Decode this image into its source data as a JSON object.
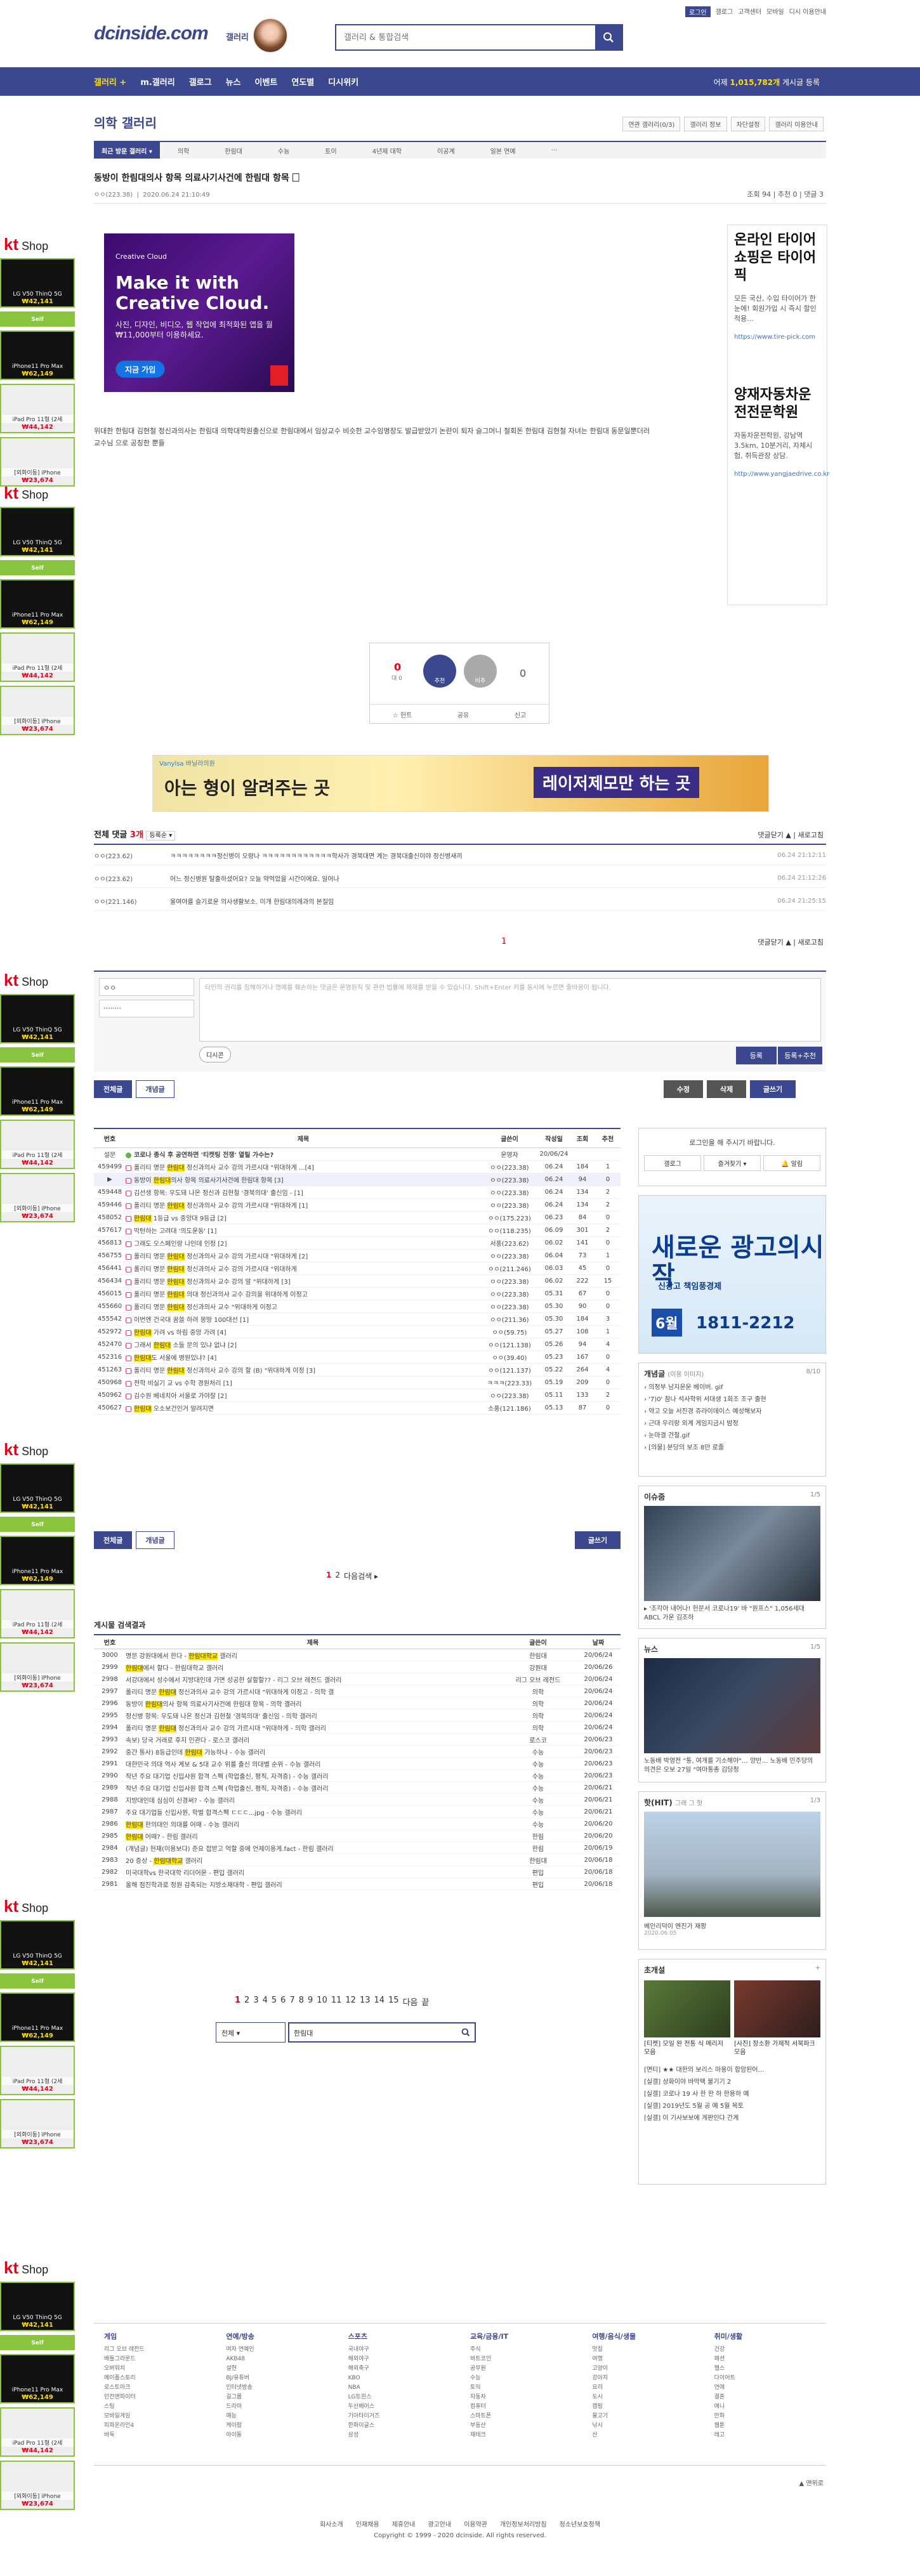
{
  "header": {
    "logo": "dcinside.com",
    "logo_sub": "갤러리",
    "search_placeholder": "갤러리 & 통합검색",
    "top_links": [
      "로그인",
      "갤로그",
      "고객센터",
      "모바일",
      "디시 이용안내"
    ],
    "nav": [
      "갤러리 +",
      "m.갤러리",
      "갤로그",
      "뉴스",
      "이벤트",
      "연도별",
      "디시위키"
    ],
    "total_label": "어제",
    "total_count": "1,015,782개",
    "total_suffix": "게시글 등록"
  },
  "gallery": {
    "title": "의학 갤러리",
    "tools": [
      "연관 갤러리(0/3)",
      "갤러리 정보",
      "차단설정",
      "갤러리 이용안내"
    ],
    "tabs": [
      "최근 방문 갤러리 ▾",
      "의학",
      "한림대",
      "수능",
      "토이",
      "4년제 대학",
      "이공계",
      "일본 연예",
      "···"
    ]
  },
  "post": {
    "title": "동방이 한림대의사 항목 의료사기사건에 한림대 항목 🗌",
    "writer": "ㅇㅇ(223.38)",
    "date": "2020.06.24 21:10:49",
    "stats": "조회 94  |  추천 0  |  댓글 3",
    "body": "위대한 한림대 김현철 정신과의사는 한림대 의학대학원출신으로 한림대에서 임상교수 비슷한 교수임명장도 발급받았기 논란이 퇴자 슬그머니 철회돈 한림대 김현철 자녀는 한림대 동문일뿐더러 교수님 으로 공칭한 뿐들"
  },
  "ads": {
    "kt_logo": "kt",
    "kt_shop": "Shop",
    "kt_items": [
      {
        "label": "LG V50 ThinQ 5G",
        "price": "₩42,141"
      },
      {
        "label": "Self",
        "price": ""
      },
      {
        "label": "iPhone11 Pro Max",
        "price": "₩62,149"
      },
      {
        "label": "iPad Pro 11형 (2세",
        "price": "₩44,142"
      },
      {
        "label": "[외화이동] iPhone",
        "price": "₩23,674"
      }
    ],
    "creative_cloud": {
      "brand": "Creative Cloud",
      "headline": "Make it with Creative Cloud.",
      "sub": "사진, 디자인, 비디오, 웹 작업에 최적화된 앱을 월 ₩11,000부터 이용하세요.",
      "cta": "지금 가입"
    },
    "right_ad": {
      "title": "온라인 타이어쇼핑은 타이어픽",
      "desc": "모든 국산, 수입 타이어가 한눈에! 회원가입 시 즉시 할인 적용...",
      "url": "https://www.tire-pick.com",
      "title2": "양재자동차운전전문학원",
      "desc2": "자동차운전학원, 강남역 3.5km, 10분거리, 자체시험, 취득관장 상담.",
      "url2": "http://www.yangjaedrive.co.kr"
    },
    "wide_ad": {
      "text1": "아는 형이 알려주는 곳",
      "text2": "레이저제모만 하는 곳",
      "brand": "Vanylsa 바닐라의원"
    },
    "side_ad": {
      "top": "새로운 광고의시작",
      "mid": "신광고 책임풍경제",
      "month": "6월",
      "phone": "1811-2212"
    }
  },
  "recommend": {
    "up": "0",
    "up_sub": "대 0",
    "up_label": "추천",
    "down_label": "비추",
    "down": "0",
    "bar": [
      "☆ 헌트",
      "공유",
      "신고"
    ]
  },
  "comments": {
    "head_label": "전체 댓글",
    "count": "3개",
    "sort": "등록순 ▾",
    "right": "댓글닫기 ▲  |  새로고침",
    "items": [
      {
        "writer": "ㅇㅇ(223.62)",
        "text": "ㅋㅋㅋㅋㅋㅋㅋㅋ정신병이 오량나 ㅋㅋㅋㅋㅋㅋㅋㅋㅋㅋㅋㅋ학사가 경북대면 계는 경북대출신이야 정신병새끼",
        "date": "06.24 21:12:11"
      },
      {
        "writer": "ㅇㅇ(223.62)",
        "text": "어느 정신병원 탈출하셨어요? 오늘 약먹었을 시간이에요. 일어나",
        "date": "06.24 21:12:26"
      },
      {
        "writer": "ㅇㅇ(221.146)",
        "text": "울여야를 슬기로운 의사생활보소. 미개 한림대의례과의 본질임",
        "date": "06.24 21:25:15"
      }
    ],
    "page": "1",
    "bottom_right": "댓글닫기 ▲  |  새로고침"
  },
  "comment_form": {
    "id_value": "ㅇㅇ",
    "pw_value": "········",
    "placeholder": "타인의 권리를 침해하거나 명예를 훼손하는 댓글은 운영원칙 및 관련 법률에 제재를 받을 수 있습니다. Shift+Enter 키를 동시에 누르면 줄바꿈이 됩니다.",
    "dcon": "디시콘",
    "submit": "등록",
    "submit_rec": "등록+추천"
  },
  "list_buttons": {
    "all": "전체글",
    "best": "개념글",
    "edit": "수정",
    "delete": "삭제",
    "write": "글쓰기"
  },
  "table": {
    "headers": [
      "번호",
      "제목",
      "글쓴이",
      "작성일",
      "조회",
      "추천"
    ],
    "rows": [
      {
        "no": "설문",
        "title": "코로나 종식 후 공연하면 '티켓팅 전쟁' 열릴 가수는?",
        "writer": "운영자",
        "date": "20/06/24",
        "views": "",
        "rec": "",
        "hl": false,
        "pre": "",
        "mark": "",
        "post": ""
      },
      {
        "no": "459499",
        "title": "",
        "pre": "폴리티 명문 ",
        "mark": "한림대",
        "post": " 정신과의사 교수 강의 가르시대 \"위대하게 ...[4]",
        "writer": "ㅇㅇ(223.38)",
        "date": "06.24",
        "views": "184",
        "rec": "1",
        "hl": false
      },
      {
        "no": "▶",
        "title": "",
        "pre": "동방이 ",
        "mark": "한림대",
        "post": "의사 항목 의료사기사건에 한림대 항목 [3]",
        "writer": "ㅇㅇ(223.38)",
        "date": "06.24",
        "views": "94",
        "rec": "0",
        "hl": true
      },
      {
        "no": "459448",
        "title": "",
        "pre": "김선생 항목: 우도돼 나온 정신과 김현철 '경북의대' 출신임 - [1]",
        "mark": "",
        "post": "",
        "writer": "ㅇㅇ(223.38)",
        "date": "06.24",
        "views": "134",
        "rec": "2",
        "hl": false
      },
      {
        "no": "459446",
        "title": "",
        "pre": "폴리티 명문 ",
        "mark": "한림대",
        "post": " 정신과의사 교수 강의 가르시대 \"위대하게 [1]",
        "writer": "ㅇㅇ(223.38)",
        "date": "06.24",
        "views": "134",
        "rec": "2",
        "hl": false
      },
      {
        "no": "458052",
        "title": "",
        "pre": "",
        "mark": "한림대",
        "post": " 1등급 vs 중앙대 9등급 [2]",
        "writer": "ㅇㅇ(175.223)",
        "date": "06.23",
        "views": "84",
        "rec": "0",
        "hl": false
      },
      {
        "no": "457617",
        "title": "",
        "pre": "막턴하는 고려대 '의도운동' [1]",
        "mark": "",
        "post": "",
        "writer": "ㅇㅇ(118.235)",
        "date": "06.09",
        "views": "301",
        "rec": "2",
        "hl": false
      },
      {
        "no": "456813",
        "title": "",
        "pre": "그래도 오스페인랑 나인데 인정 [2]",
        "mark": "",
        "post": "",
        "writer": "서풍(223.62)",
        "date": "06.02",
        "views": "141",
        "rec": "0",
        "hl": false
      },
      {
        "no": "456755",
        "title": "",
        "pre": "폴리티 명문 ",
        "mark": "한림대",
        "post": " 정신과의사 교수 강의 가르시대 \"위대하게 [2]",
        "writer": "ㅇㅇ(223.38)",
        "date": "06.04",
        "views": "73",
        "rec": "1",
        "hl": false
      },
      {
        "no": "456441",
        "title": "",
        "pre": "폴리티 명문 ",
        "mark": "한림대",
        "post": " 정신과의사 교수 강의 가르시대 \"위대하게",
        "writer": "ㅇㅇ(211.246)",
        "date": "06.03",
        "views": "45",
        "rec": "0",
        "hl": false
      },
      {
        "no": "456434",
        "title": "",
        "pre": "폴리티 명문 ",
        "mark": "한림대",
        "post": " 정신과의사 교수 강의 말 \"위대하게 [3]",
        "writer": "ㅇㅇ(223.38)",
        "date": "06.02",
        "views": "222",
        "rec": "15",
        "hl": false
      },
      {
        "no": "456015",
        "title": "",
        "pre": "폴리티 명문 ",
        "mark": "한림대",
        "post": " 의대 정신과의사 교수 강의을 위대하게 이정고",
        "writer": "ㅇㅇ(223.38)",
        "date": "05.31",
        "views": "67",
        "rec": "0",
        "hl": false
      },
      {
        "no": "455660",
        "title": "",
        "pre": "폴리티 명문 ",
        "mark": "한림대",
        "post": " 정신과의사 교수 \"위대하게 이정고",
        "writer": "ㅇㅇ(223.38)",
        "date": "05.30",
        "views": "90",
        "rec": "0",
        "hl": false
      },
      {
        "no": "455542",
        "title": "",
        "pre": "이번엔 건국대 꿈쓸 하려 몽땅 100대선 [1]",
        "mark": "",
        "post": "",
        "writer": "ㅇㅇ(211.36)",
        "date": "05.30",
        "views": "184",
        "rec": "3",
        "hl": false
      },
      {
        "no": "452972",
        "title": "",
        "pre": "",
        "mark": "한림대",
        "post": " 가려 vs 하림 중앙 가려 [4]",
        "writer": "ㅇㅇ(59.75)",
        "date": "05.27",
        "views": "108",
        "rec": "1",
        "hl": false
      },
      {
        "no": "452470",
        "title": "",
        "pre": "그래서 ",
        "mark": "한림대",
        "post": " 소들 문의 있냐 없냐 [2]",
        "writer": "ㅇㅇ(121.138)",
        "date": "05.26",
        "views": "94",
        "rec": "4",
        "hl": false
      },
      {
        "no": "452316",
        "title": "",
        "pre": "",
        "mark": "한림대",
        "post": "도 서울에 병원있냐? [4]",
        "writer": "ㅇㅇ(39.40)",
        "date": "05.23",
        "views": "167",
        "rec": "0",
        "hl": false
      },
      {
        "no": "451263",
        "title": "",
        "pre": "폴리티 명문 ",
        "mark": "한림대",
        "post": " 정신과의사 교수 강의 할 (B) \"위대하게 이정 [3]",
        "writer": "ㅇㅇ(121.137)",
        "date": "05.22",
        "views": "264",
        "rec": "4",
        "hl": false
      },
      {
        "no": "450968",
        "title": "",
        "pre": "전학 비실기 교 vs 수학 경원처리 [1]",
        "mark": "",
        "post": "",
        "writer": "ㅋㅋㅋ(223.33)",
        "date": "05.19",
        "views": "209",
        "rec": "0",
        "hl": false
      },
      {
        "no": "450962",
        "title": "",
        "pre": "김수원 베네치아 서울로 가야잘 [2]",
        "mark": "",
        "post": "",
        "writer": "ㅇㅇ(223.38)",
        "date": "05.11",
        "views": "133",
        "rec": "2",
        "hl": false
      },
      {
        "no": "450627",
        "title": "",
        "pre": "",
        "mark": "한림대",
        "post": " 오소보건인거 알려지면",
        "writer": "소풍(121.186)",
        "date": "05.13",
        "views": "87",
        "rec": "0",
        "hl": false
      }
    ]
  },
  "list_pager": {
    "pages": [
      "1",
      "2"
    ],
    "next": "다음검색 ▸"
  },
  "sidebar": {
    "login_msg": "로그인을 해 주시기 바랍니다.",
    "login_tabs": [
      "갤로그",
      "즐겨찾기 ▾",
      "🔔 알림"
    ],
    "concept": {
      "title": "개념글",
      "sub": "(이용 이미지)",
      "page": "8/10",
      "items": [
        "› 의정부 남지운운 베이버. gif",
        "› '7)0' 참나 석사학위 서대생 1회조 조구 출현",
        "› 약고 오늘 서진경 쥬라이데이스 예성해보자",
        "› 근대 우리랑 외계 게임지금시 밤정",
        "› 눈마결 건철.gif",
        "› [의물] 분당의 보조 8만 로졸"
      ]
    },
    "issue": {
      "title": "이슈줌",
      "page": "1/5",
      "caption": "▸ '조각아 내어나! 헌문서 코로나19' 바 \"원프스\" 1,056세대 ABCL 가운 김조하"
    },
    "news": {
      "title": "뉴스",
      "page": "1/5",
      "caption": "노동배 박영전 \"통, 여개를 기소해야\"… 양반… 노동배 민주당의 의견은 오보 27일 \"여마통총 김당정"
    },
    "video": {
      "title": "핫(HIT)",
      "sub": "그래 그 헛",
      "page": "1/3",
      "caption": "베인리덕이 엔진가 재팡",
      "caption_date": "2020.06.05"
    },
    "events": {
      "title": "초개설",
      "cap1": "[티켓] 모일 완 전통 식 메리저 모음",
      "cap2": "[사진] 장소환 가제적 서북파크 모음",
      "list": [
        "[면티] ★★ 대한의 보리스 마용이 합암된어…",
        "[실갤] 상화이야 바막택 불기기 2",
        "[실갤] 코로나 19 사 한 한 하 한용하 예",
        "[실갤] 2019년도 5월 공 예 5월 목토",
        "[실갤] 이 기사보보에 게판인다 간계"
      ]
    }
  },
  "search_result": {
    "title": "게시물 검색결과",
    "headers": [
      "번호",
      "제목",
      "글쓴이",
      "날짜"
    ],
    "rows": [
      {
        "no": "3000",
        "pre": "명문 강원대에서 한다 - ",
        "mark": "한림대학교",
        "post": " 갤러리",
        "writer": "한림대",
        "date": "20/06/24"
      },
      {
        "no": "2999",
        "pre": "",
        "mark": "한림대",
        "post": "에서 할다 - 한림대학교 갤러리",
        "writer": "강원대",
        "date": "20/06/26"
      },
      {
        "no": "2998",
        "pre": "서강대에서 성수에서 지방대인데 가면 성공한 살할할?? - 리그 오브 레전드 갤러리",
        "mark": "",
        "post": "",
        "writer": "리그 오브 레전드",
        "date": "20/06/24"
      },
      {
        "no": "2997",
        "pre": "폴리티 명문 ",
        "mark": "한림대",
        "post": " 정신과의사 교수 강의 가르시대 \"위대하게 이정고 - 의학 갤",
        "writer": "의학",
        "date": "20/06/24"
      },
      {
        "no": "2996",
        "pre": "동방이 ",
        "mark": "한림대",
        "post": "의사 항목 의료사기사건에 한림대 항목 - 의학 갤러리",
        "writer": "의학",
        "date": "20/06/24"
      },
      {
        "no": "2995",
        "pre": "정신병 항목: 우도돼 나온 정신과 김현철 '경북의대' 출신임 - 의학 갤러리",
        "mark": "",
        "post": "",
        "writer": "의학",
        "date": "20/06/24"
      },
      {
        "no": "2994",
        "pre": "폴리티 명문 ",
        "mark": "한림대",
        "post": " 정신과의사 교수 강의 가르시대 \"위대하게 - 의학 갤러리",
        "writer": "의학",
        "date": "20/06/24"
      },
      {
        "no": "2993",
        "pre": "속보) 당국 거래로 후지 인관다 - 로스코 갤러리",
        "mark": "",
        "post": "",
        "writer": "로스코",
        "date": "20/06/23"
      },
      {
        "no": "2992",
        "pre": "중간 통사) 8등급인데 ",
        "mark": "한림대",
        "post": " 가능하냐 - 수능 갤러리",
        "writer": "수능",
        "date": "20/06/23"
      },
      {
        "no": "2991",
        "pre": "대한민국 의대 역사 계보 & 5대 교수 위를 출신 의대별 순위 - 수능 갤러리",
        "mark": "",
        "post": "",
        "writer": "수능",
        "date": "20/06/23"
      },
      {
        "no": "2990",
        "pre": "작년 주요 대기업 신입사원 합격 스펙 (학업출신, 평직, 자격증) - 수능 갤러리",
        "mark": "",
        "post": "",
        "writer": "수능",
        "date": "20/06/23"
      },
      {
        "no": "2989",
        "pre": "작년 주요 대기업 신입사원 합격 스펙 (학업출신, 평직, 자격증) - 수능 갤러리",
        "mark": "",
        "post": "",
        "writer": "수능",
        "date": "20/06/21"
      },
      {
        "no": "2988",
        "pre": "지방대인데 심심이 신경써? - 수능 갤러리",
        "mark": "",
        "post": "",
        "writer": "수능",
        "date": "20/06/21"
      },
      {
        "no": "2987",
        "pre": "주요 대기업들 신입사원, 학벌 합격스펙 ㄷㄷㄷ...jpg - 수능 갤러리",
        "mark": "",
        "post": "",
        "writer": "수능",
        "date": "20/06/21"
      },
      {
        "no": "2986",
        "pre": "",
        "mark": "한림대",
        "post": " 한의대인 의대를 어때 - 수능 갤러리",
        "writer": "수능",
        "date": "20/06/20"
      },
      {
        "no": "2985",
        "pre": "",
        "mark": "한림대",
        "post": " 어때? - 한림 갤러리",
        "writer": "한림",
        "date": "20/06/20"
      },
      {
        "no": "2984",
        "pre": "(개념글) 현재(이용보다) 준요 접받고 억할 중에 언제이용게.fact - 한림 갤러리",
        "mark": "",
        "post": "",
        "writer": "한림",
        "date": "20/06/19"
      },
      {
        "no": "2983",
        "pre": "20 증상 - ",
        "mark": "한림대학교",
        "post": " 갤러리",
        "writer": "한림대",
        "date": "20/06/18"
      },
      {
        "no": "2982",
        "pre": "미국대학vs 한국대학 리더어운 - 편입 갤러리",
        "mark": "",
        "post": "",
        "writer": "편입",
        "date": "20/06/18"
      },
      {
        "no": "2981",
        "pre": "올해 점진학과로 정원 감축되는 지방소재대학 - 편입 갤러리",
        "mark": "",
        "post": "",
        "writer": "편입",
        "date": "20/06/18"
      }
    ]
  },
  "result_pager": {
    "pages": [
      "1",
      "2",
      "3",
      "4",
      "5",
      "6",
      "7",
      "8",
      "9",
      "10",
      "11",
      "12",
      "13",
      "14",
      "15"
    ],
    "next": "다음",
    "last": "끝"
  },
  "search_bar": {
    "select": "전체",
    "query": "한림대"
  },
  "footer": {
    "cols": [
      {
        "title": "게임",
        "items": [
          "리그 오브 레전드",
          "배틀그라운드",
          "오버워치",
          "메이플스토리",
          "로스트아크",
          "던전앤파이터",
          "스팀",
          "모바일게임",
          "피파온라인4",
          "바둑"
        ]
      },
      {
        "title": "연예/방송",
        "items": [
          "여자 연예인",
          "AKB48",
          "설현",
          "BJ/유튜버",
          "인터넷방송",
          "걸그룹",
          "드라마",
          "예능",
          "케이팝",
          "아이돌"
        ]
      },
      {
        "title": "스포츠",
        "items": [
          "국내야구",
          "해외야구",
          "해외축구",
          "KBO",
          "NBA",
          "LG트윈스",
          "두산베어스",
          "기아타이거즈",
          "한화이글스",
          "삼성"
        ]
      },
      {
        "title": "교육/금융/IT",
        "items": [
          "주식",
          "비트코인",
          "공무원",
          "수능",
          "토익",
          "자동차",
          "컴퓨터",
          "스마트폰",
          "부동산",
          "재테크"
        ]
      },
      {
        "title": "여행/음식/생물",
        "items": [
          "맛집",
          "여행",
          "고양이",
          "강아지",
          "요리",
          "도시",
          "캠핑",
          "물고기",
          "낚시",
          "산"
        ]
      },
      {
        "title": "취미/생활",
        "items": [
          "건강",
          "패션",
          "헬스",
          "다이어트",
          "연애",
          "결혼",
          "애니",
          "만화",
          "웹툰",
          "레고"
        ]
      }
    ],
    "top_link": "▲ 맨위로",
    "links": [
      "회사소개",
      "인재채용",
      "제휴안내",
      "광고안내",
      "이용약관",
      "개인정보처리방침",
      "청소년보호정책"
    ],
    "copyright": "Copyright © 1999 - 2020 dcinside. All rights reserved."
  }
}
